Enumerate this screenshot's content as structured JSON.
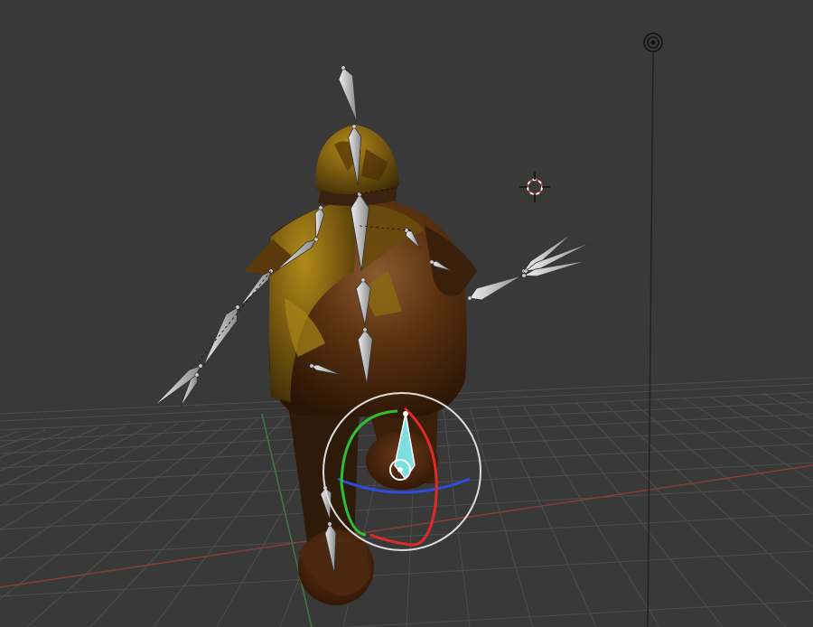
{
  "viewport": {
    "background_color": "#393939",
    "grid_color": "#4d4d4d",
    "x_axis_color": "#8a3a3a",
    "y_axis_color": "#3f7a3f",
    "mode": "pose"
  },
  "scene_objects": {
    "lamp_icon": "lamp-icon",
    "camera_line_icon": "lamp-line",
    "cursor_icon": "3d-cursor-icon"
  },
  "character": {
    "body_color": "#5b3412",
    "cloak_color": "#7a5a10",
    "highlight_color": "#a88418",
    "bone_color": "#b8b8b8"
  },
  "rotate_gizmo": {
    "x_ring_color": "#e03030",
    "y_ring_color": "#30c030",
    "z_ring_color": "#3050e0",
    "view_ring_color": "#dddddd",
    "selected_bone_color": "#7de0e0"
  }
}
